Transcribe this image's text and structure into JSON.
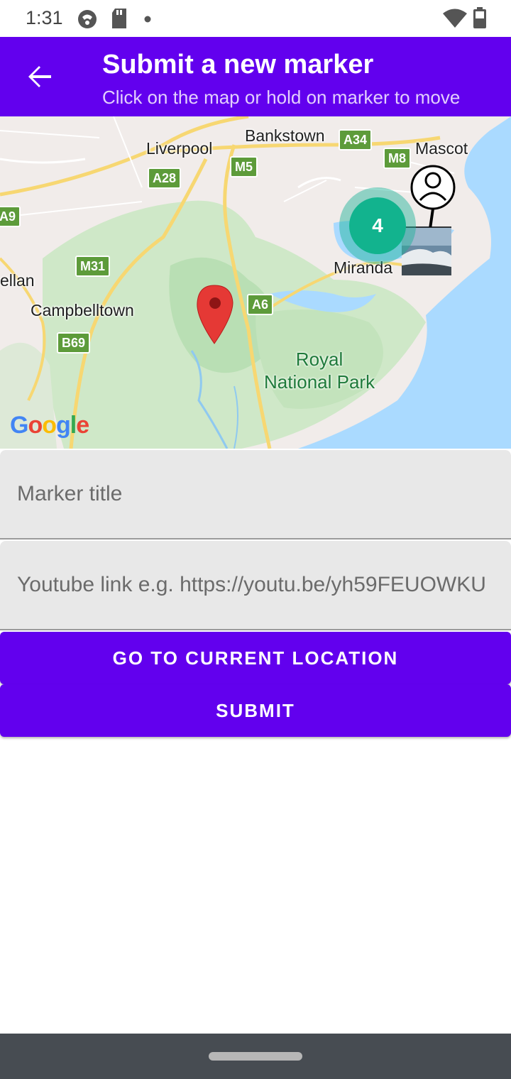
{
  "status_bar": {
    "time": "1:31",
    "left_icons": [
      "app-notification-icon",
      "sd-card-icon",
      "dot-icon"
    ],
    "right_icons": [
      "wifi-icon",
      "battery-icon"
    ]
  },
  "app_bar": {
    "back_icon": "arrow-back-icon",
    "title": "Submit a new marker",
    "subtitle": "Click on the map or hold on marker to move"
  },
  "map": {
    "place_labels": [
      "Bankstown",
      "Liverpool",
      "Mascot",
      "Miranda",
      "ellan",
      "Campbelltown"
    ],
    "park_label": [
      "Royal",
      "National Park"
    ],
    "route_shields": [
      "A34",
      "M8",
      "M5",
      "A28",
      "A9",
      "M31",
      "A6",
      "B69"
    ],
    "cluster_count": "4",
    "attribution": "Google",
    "markers": [
      "red-location-pin-icon",
      "user-profile-marker-icon",
      "beach-photo-marker"
    ]
  },
  "form": {
    "title_placeholder": "Marker title",
    "link_placeholder": "Youtube link e.g. https://youtu.be/yh59FEUOWKU",
    "current_location_label": "Go to current location",
    "submit_label": "Submit"
  },
  "colors": {
    "primary": "#6200ee",
    "cluster": "#12b38e",
    "field_background": "#e8e8e8",
    "nav_bar": "#474c52"
  }
}
